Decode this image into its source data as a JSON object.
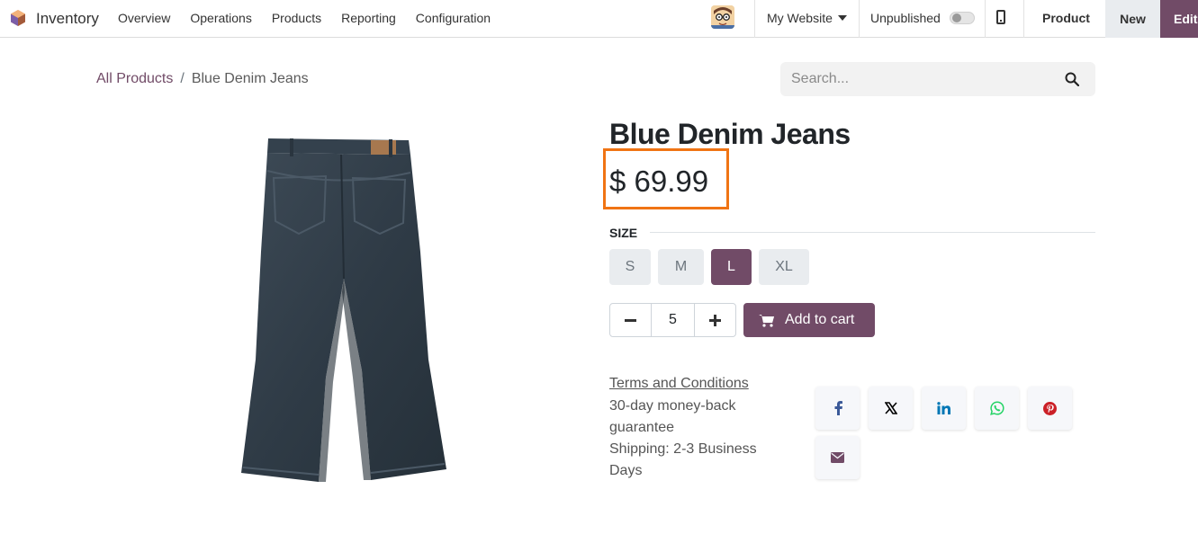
{
  "app": {
    "name": "Inventory"
  },
  "menu": [
    "Overview",
    "Operations",
    "Products",
    "Reporting",
    "Configuration"
  ],
  "website": {
    "selected": "My Website"
  },
  "publish": {
    "label": "Unpublished",
    "published": false
  },
  "actions": {
    "product": "Product",
    "new": "New",
    "edit": "Edit"
  },
  "breadcrumb": {
    "root": "All Products",
    "separator": "/",
    "current": "Blue Denim Jeans"
  },
  "search": {
    "placeholder": "Search..."
  },
  "product": {
    "name": "Blue Denim Jeans",
    "price": "$ 69.99",
    "size_label": "SIZE",
    "sizes": [
      "S",
      "M",
      "L",
      "XL"
    ],
    "selected_size": "L",
    "quantity": "5",
    "add_to_cart": "Add to cart"
  },
  "info": {
    "terms": "Terms and Conditions",
    "guarantee_1": "30-day money-back",
    "guarantee_2": "guarantee",
    "shipping_1": "Shipping: 2-3 Business",
    "shipping_2": "Days"
  },
  "share_icons": [
    "facebook-icon",
    "x-twitter-icon",
    "linkedin-icon",
    "whatsapp-icon",
    "pinterest-icon",
    "email-icon"
  ],
  "colors": {
    "brand": "#714b67",
    "highlight": "#f07414"
  }
}
